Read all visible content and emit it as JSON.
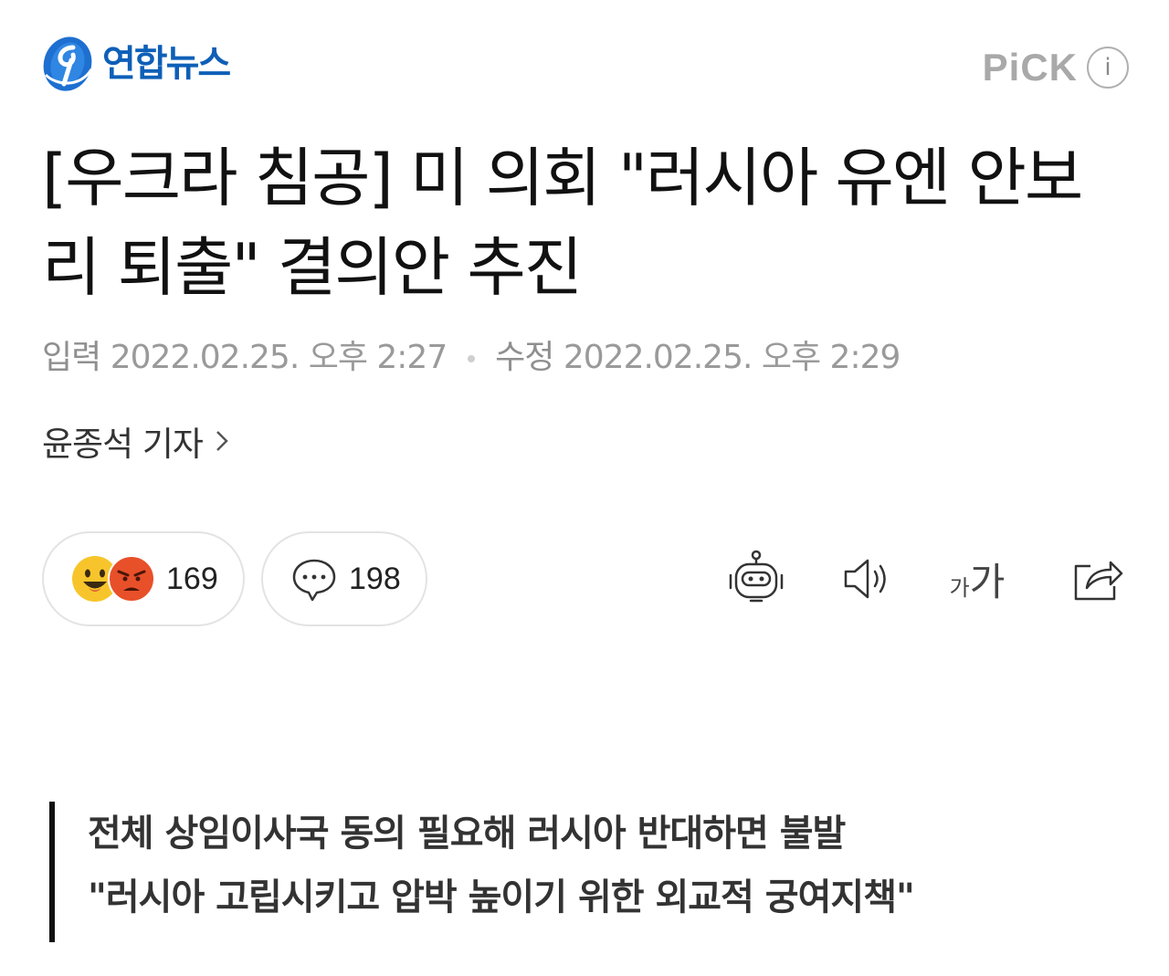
{
  "header": {
    "logo_text": "연합뉴스",
    "logo_mark": "yonhap-logo",
    "pick_label": "PiCK",
    "info_label": "i"
  },
  "article": {
    "title": "[우크라 침공] 미 의회 \"러시아 유엔 안보리 퇴출\" 결의안 추진",
    "input_label": "입력",
    "input_time": "2022.02.25. 오후 2:27",
    "edit_label": "수정",
    "edit_time": "2022.02.25. 오후 2:29",
    "reporter": "윤종석 기자"
  },
  "actions": {
    "reaction_count": "169",
    "comment_count": "198",
    "font_small": "가",
    "font_big": "가",
    "icons": [
      "smile-emoji",
      "angry-emoji",
      "comment-icon",
      "robot-summary-icon",
      "speaker-icon",
      "font-size-icon",
      "share-icon"
    ]
  },
  "summary": {
    "line1": "전체 상임이사국 동의 필요해 러시아 반대하면 불발",
    "line2": "\"러시아 고립시키고 압박 높이기 위한 외교적 궁여지책\""
  },
  "colors": {
    "logo_blue": "#0e5fb7",
    "pick_gray": "#a9a9a9",
    "smile_yellow": "#f7c52b",
    "angry_red": "#e8502a"
  }
}
